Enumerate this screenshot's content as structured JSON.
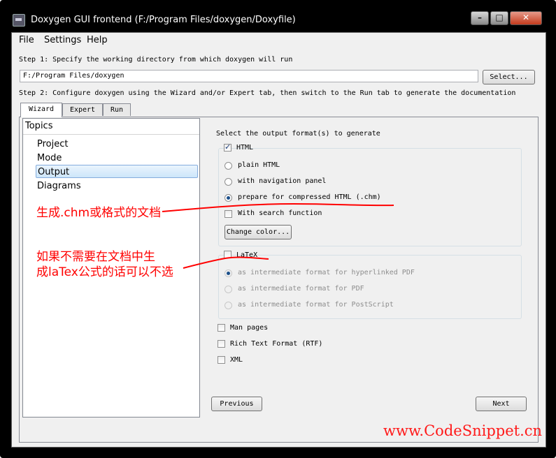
{
  "window": {
    "title": "Doxygen GUI frontend (F:/Program Files/doxygen/Doxyfile)"
  },
  "menu": [
    "File",
    "Settings",
    "Help"
  ],
  "step1": {
    "label": "Step 1: Specify the working directory from which doxygen will run",
    "value": "F:/Program Files/doxygen",
    "select_label": "Select..."
  },
  "step2": {
    "label": "Step 2: Configure doxygen using the Wizard and/or Expert tab, then switch to the Run tab to generate the documentation"
  },
  "tabs": [
    "Wizard",
    "Expert",
    "Run"
  ],
  "topics": {
    "header": "Topics",
    "items": [
      "Project",
      "Mode",
      "Output",
      "Diagrams"
    ],
    "selected": "Output"
  },
  "output": {
    "title": "Select the output format(s) to generate",
    "html": {
      "label": "HTML",
      "checked": true,
      "options": [
        "plain HTML",
        "with navigation panel",
        "prepare for compressed HTML (.chm)"
      ],
      "selected_option": "prepare for compressed HTML (.chm)",
      "search_label": "With search function",
      "color_button": "Change color..."
    },
    "latex": {
      "label": "LaTeX",
      "checked": false,
      "options": [
        "as intermediate format for hyperlinked PDF",
        "as intermediate format for PDF",
        "as intermediate format for PostScript"
      ]
    },
    "man_label": "Man pages",
    "rtf_label": "Rich Text Format (RTF)",
    "xml_label": "XML"
  },
  "nav": {
    "previous": "Previous",
    "next": "Next"
  },
  "annotations": {
    "chm_note": "生成.chm或格式的文档",
    "latex_note_line1": "如果不需要在文档中生",
    "latex_note_line2": "成laTex公式的话可以不选"
  },
  "watermark": "www.CodeSnippet.cn",
  "colors": {
    "annotation": "#ff0000",
    "selection": "#cde6fa",
    "titlebar": "#000000"
  }
}
